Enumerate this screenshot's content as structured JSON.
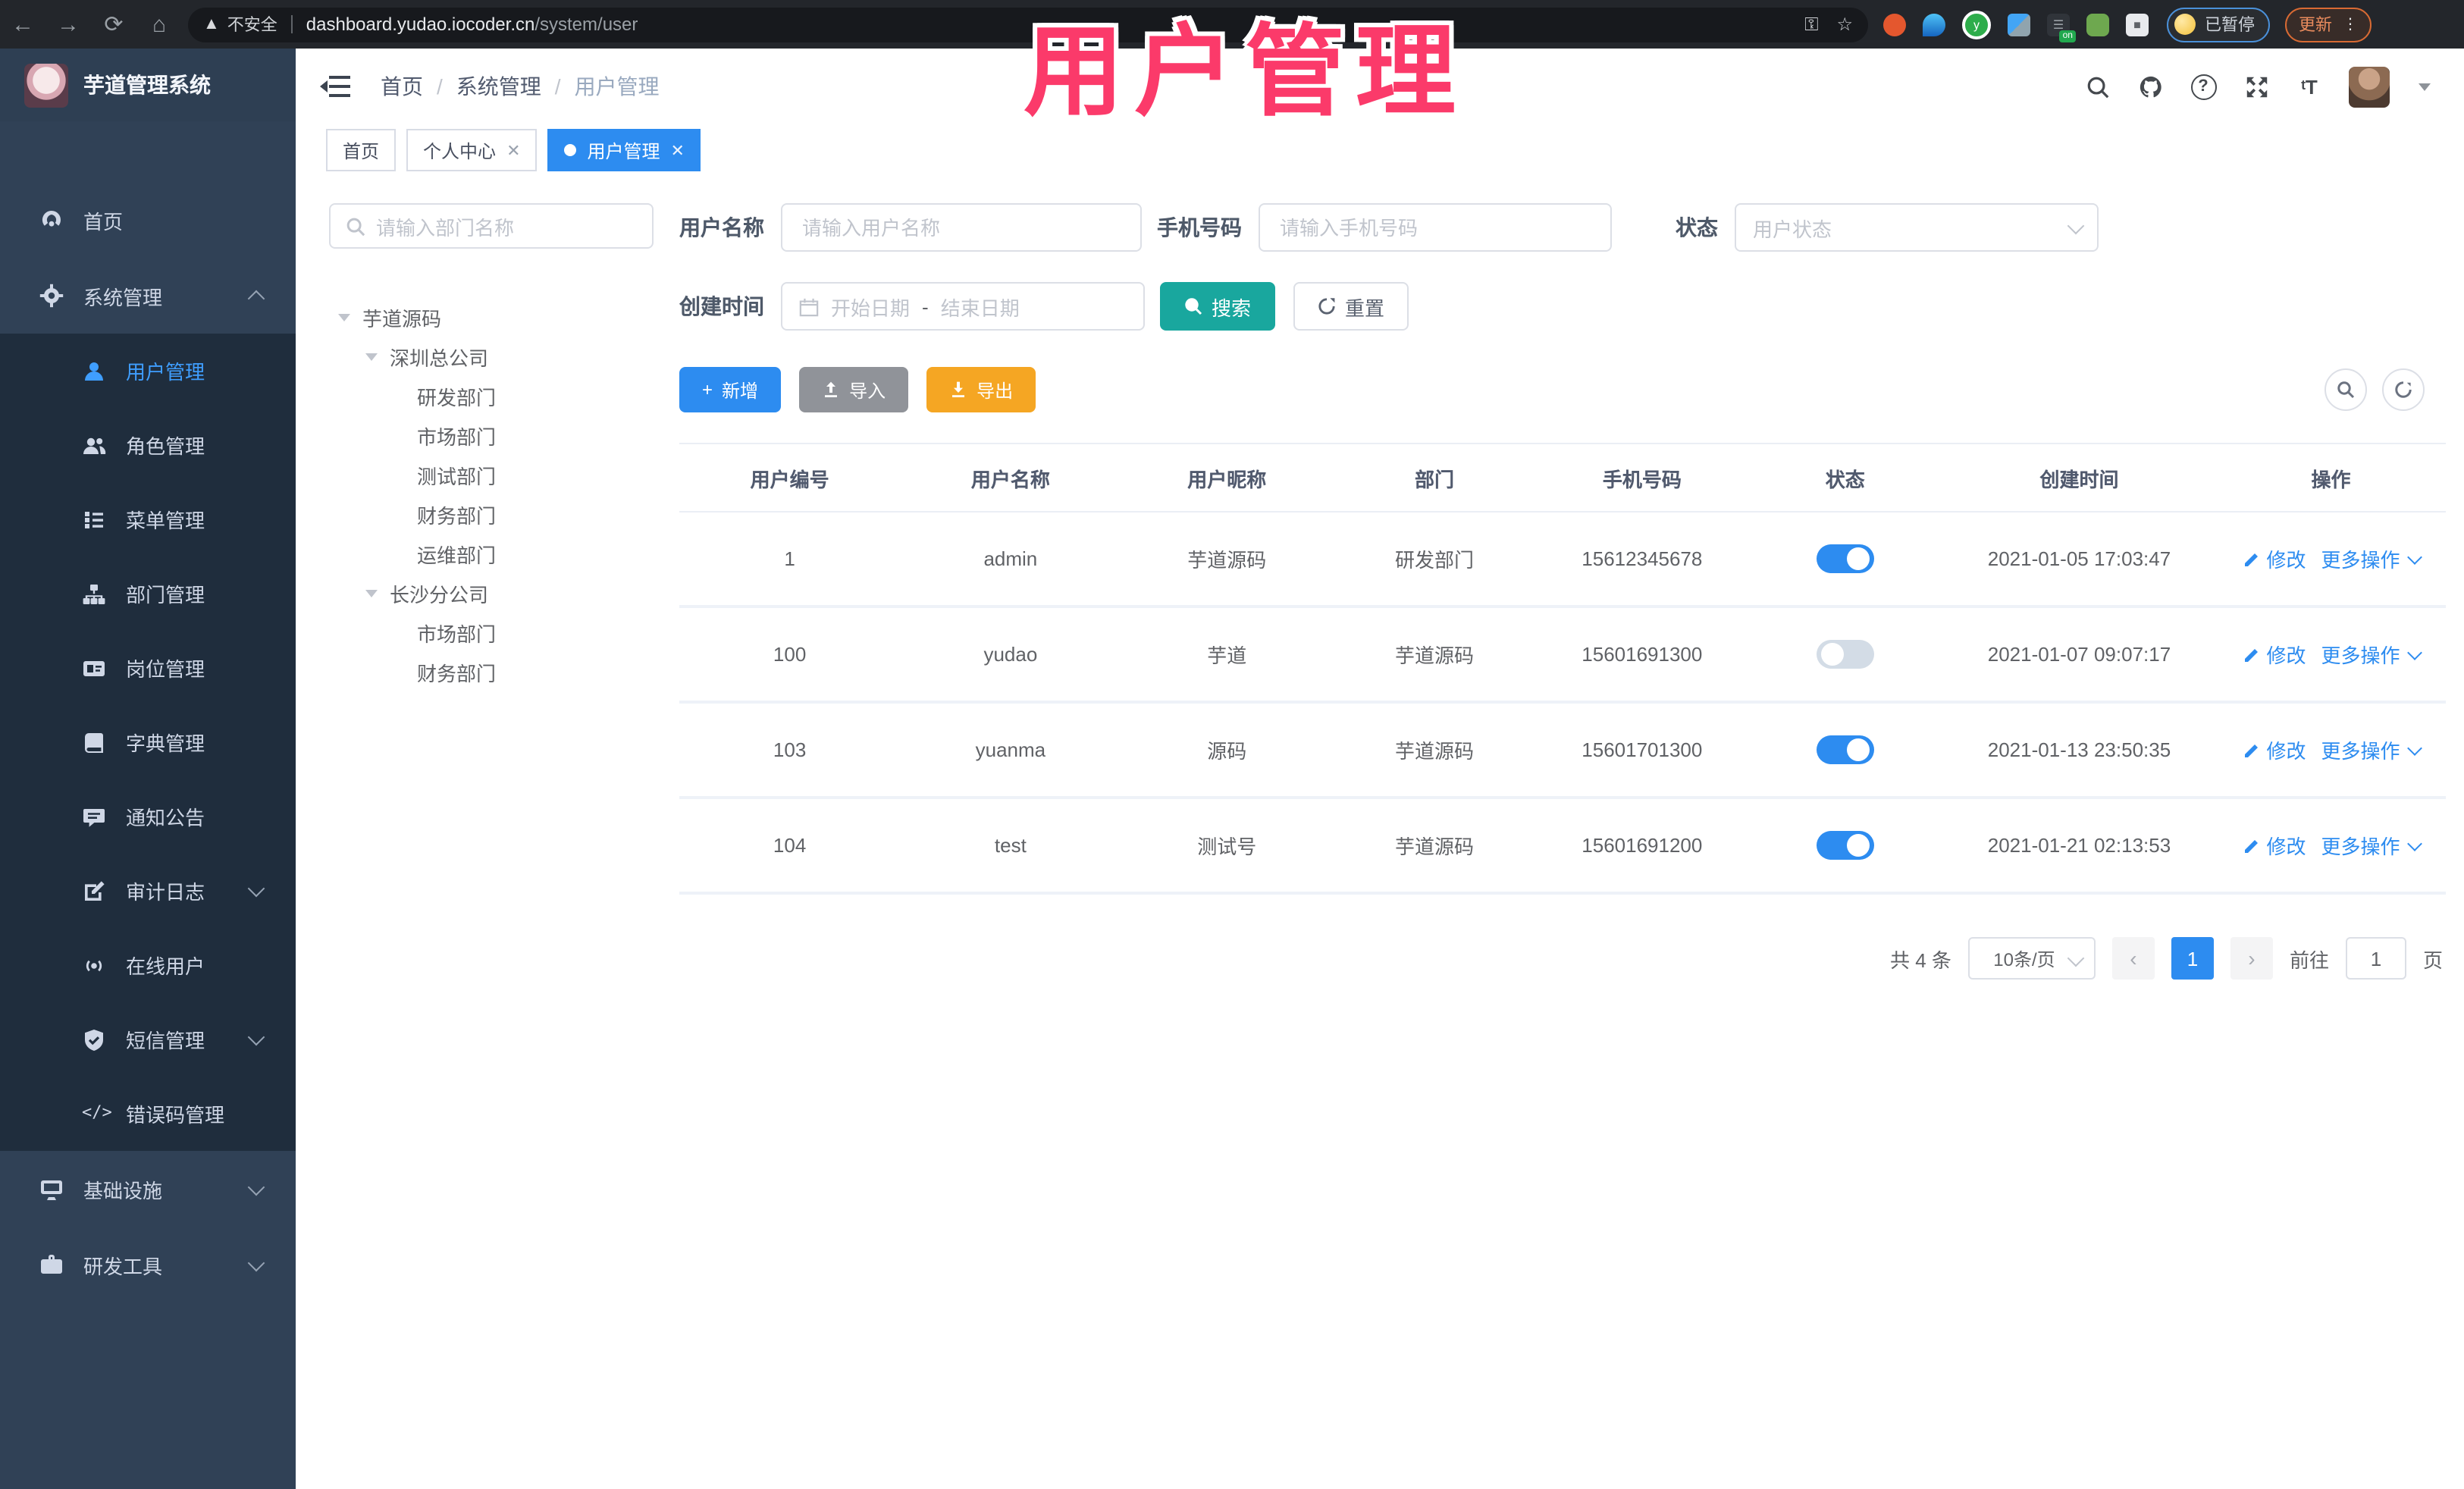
{
  "browser": {
    "not_secure_label": "不安全",
    "url_host": "dashboard.yudao.iocoder.cn",
    "url_path": "/system/user",
    "paused_badge": "已暂停",
    "update_button": "更新"
  },
  "overlay": {
    "text": "用户管理",
    "color": "#fb3a6a"
  },
  "app": {
    "title": "芋道管理系统"
  },
  "breadcrumb": {
    "items": [
      "首页",
      "系统管理",
      "用户管理"
    ]
  },
  "tabs": [
    {
      "label": "首页",
      "active": false,
      "closable": false
    },
    {
      "label": "个人中心",
      "active": false,
      "closable": true
    },
    {
      "label": "用户管理",
      "active": true,
      "closable": true
    }
  ],
  "sidebar": {
    "items": [
      {
        "label": "首页",
        "icon": "dashboard-icon",
        "level": "top"
      },
      {
        "label": "系统管理",
        "icon": "gear-icon",
        "level": "top",
        "arrow": "up"
      },
      {
        "label": "用户管理",
        "icon": "user-icon",
        "level": "sub",
        "active": true
      },
      {
        "label": "角色管理",
        "icon": "users-icon",
        "level": "sub"
      },
      {
        "label": "菜单管理",
        "icon": "menu-list-icon",
        "level": "sub"
      },
      {
        "label": "部门管理",
        "icon": "org-tree-icon",
        "level": "sub"
      },
      {
        "label": "岗位管理",
        "icon": "post-badge-icon",
        "level": "sub"
      },
      {
        "label": "字典管理",
        "icon": "dictionary-icon",
        "level": "sub"
      },
      {
        "label": "通知公告",
        "icon": "announcement-icon",
        "level": "sub"
      },
      {
        "label": "审计日志",
        "icon": "audit-log-icon",
        "level": "sub",
        "arrow": "down"
      },
      {
        "label": "在线用户",
        "icon": "online-users-icon",
        "level": "sub"
      },
      {
        "label": "短信管理",
        "icon": "sms-shield-icon",
        "level": "sub",
        "arrow": "down"
      },
      {
        "label": "错误码管理",
        "icon": "error-code-icon",
        "level": "sub"
      },
      {
        "label": "基础设施",
        "icon": "infrastructure-icon",
        "level": "top",
        "arrow": "down"
      },
      {
        "label": "研发工具",
        "icon": "dev-tools-icon",
        "level": "top",
        "arrow": "down"
      }
    ]
  },
  "dept_panel": {
    "search_placeholder": "请输入部门名称",
    "tree": [
      {
        "label": "芋道源码",
        "indent": "d0",
        "caret": true
      },
      {
        "label": "深圳总公司",
        "indent": "d1",
        "caret": true
      },
      {
        "label": "研发部门",
        "indent": "d2",
        "caret": false
      },
      {
        "label": "市场部门",
        "indent": "d2",
        "caret": false
      },
      {
        "label": "测试部门",
        "indent": "d2",
        "caret": false
      },
      {
        "label": "财务部门",
        "indent": "d2",
        "caret": false
      },
      {
        "label": "运维部门",
        "indent": "d2",
        "caret": false
      },
      {
        "label": "长沙分公司",
        "indent": "d1",
        "caret": true
      },
      {
        "label": "市场部门",
        "indent": "d2",
        "caret": false
      },
      {
        "label": "财务部门",
        "indent": "d2",
        "caret": false
      }
    ]
  },
  "filters": {
    "username_label": "用户名称",
    "username_placeholder": "请输入用户名称",
    "mobile_label": "手机号码",
    "mobile_placeholder": "请输入手机号码",
    "status_label": "状态",
    "status_placeholder": "用户状态",
    "create_time_label": "创建时间",
    "start_placeholder": "开始日期",
    "range_separator": "-",
    "end_placeholder": "结束日期",
    "search_button": "搜索",
    "reset_button": "重置"
  },
  "toolbar": {
    "add_label": "新增",
    "import_label": "导入",
    "export_label": "导出"
  },
  "table": {
    "columns": [
      "用户编号",
      "用户名称",
      "用户昵称",
      "部门",
      "手机号码",
      "状态",
      "创建时间",
      "操作"
    ],
    "edit_label": "修改",
    "more_label": "更多操作",
    "rows": [
      {
        "id": "1",
        "username": "admin",
        "nickname": "芋道源码",
        "dept": "研发部门",
        "mobile": "15612345678",
        "on": true,
        "create_time": "2021-01-05 17:03:47"
      },
      {
        "id": "100",
        "username": "yudao",
        "nickname": "芋道",
        "dept": "芋道源码",
        "mobile": "15601691300",
        "on": false,
        "create_time": "2021-01-07 09:07:17"
      },
      {
        "id": "103",
        "username": "yuanma",
        "nickname": "源码",
        "dept": "芋道源码",
        "mobile": "15601701300",
        "on": true,
        "create_time": "2021-01-13 23:50:35"
      },
      {
        "id": "104",
        "username": "test",
        "nickname": "测试号",
        "dept": "芋道源码",
        "mobile": "15601691200",
        "on": true,
        "create_time": "2021-01-21 02:13:53"
      }
    ]
  },
  "pagination": {
    "total_text": "共 4 条",
    "page_size_text": "10条/页",
    "current_page": "1",
    "goto_label": "前往",
    "goto_value": "1",
    "page_unit": "页"
  },
  "colors": {
    "primary": "#2d8cf0",
    "search_button": "#19a79e",
    "export_button": "#f5a623",
    "import_button": "#909399",
    "sidebar_bg": "#304156",
    "submenu_bg": "#1f2d3d",
    "overlay_pink": "#fb3a6a",
    "toggle_off": "#d3dce6"
  }
}
